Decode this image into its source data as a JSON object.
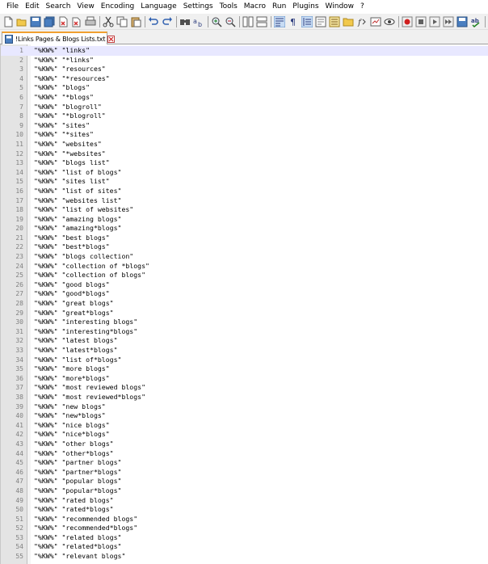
{
  "menu": [
    "File",
    "Edit",
    "Search",
    "View",
    "Encoding",
    "Language",
    "Settings",
    "Tools",
    "Macro",
    "Run",
    "Plugins",
    "Window",
    "?"
  ],
  "tab": {
    "title": "!Links Pages & Blogs Lists.txt",
    "icon": "file-saved-icon"
  },
  "colors": {
    "gutter_bg": "#e4e4e4",
    "current_line_bg": "#e8e8ff",
    "tab_accent": "#f0a030"
  },
  "editor": {
    "lines": [
      {
        "n": "1",
        "text": "\"%KW%\" \"links\""
      },
      {
        "n": "2",
        "text": "\"%KW%\" \"*links\""
      },
      {
        "n": "3",
        "text": "\"%KW%\" \"resources\""
      },
      {
        "n": "4",
        "text": "\"%KW%\" \"*resources\""
      },
      {
        "n": "5",
        "text": "\"%KW%\" \"blogs\""
      },
      {
        "n": "6",
        "text": "\"%KW%\" \"*blogs\""
      },
      {
        "n": "7",
        "text": "\"%KW%\" \"blogroll\""
      },
      {
        "n": "8",
        "text": "\"%KW%\" \"*blogroll\""
      },
      {
        "n": "9",
        "text": "\"%KW%\" \"sites\""
      },
      {
        "n": "10",
        "text": "\"%KW%\" \"*sites\""
      },
      {
        "n": "11",
        "text": "\"%KW%\" \"websites\""
      },
      {
        "n": "12",
        "text": "\"%KW%\" \"*websites\""
      },
      {
        "n": "13",
        "text": "\"%KW%\" \"blogs list\""
      },
      {
        "n": "14",
        "text": "\"%KW%\" \"list of blogs\""
      },
      {
        "n": "15",
        "text": "\"%KW%\" \"sites list\""
      },
      {
        "n": "16",
        "text": "\"%KW%\" \"list of sites\""
      },
      {
        "n": "17",
        "text": "\"%KW%\" \"websites list\""
      },
      {
        "n": "18",
        "text": "\"%KW%\" \"list of websites\""
      },
      {
        "n": "19",
        "text": "\"%KW%\" \"amazing blogs\""
      },
      {
        "n": "20",
        "text": "\"%KW%\" \"amazing*blogs\""
      },
      {
        "n": "21",
        "text": "\"%KW%\" \"best blogs\""
      },
      {
        "n": "22",
        "text": "\"%KW%\" \"best*blogs\""
      },
      {
        "n": "23",
        "text": "\"%KW%\" \"blogs collection\""
      },
      {
        "n": "24",
        "text": "\"%KW%\" \"collection of *blogs\""
      },
      {
        "n": "25",
        "text": "\"%KW%\" \"collection of blogs\""
      },
      {
        "n": "26",
        "text": "\"%KW%\" \"good blogs\""
      },
      {
        "n": "27",
        "text": "\"%KW%\" \"good*blogs\""
      },
      {
        "n": "28",
        "text": "\"%KW%\" \"great blogs\""
      },
      {
        "n": "29",
        "text": "\"%KW%\" \"great*blogs\""
      },
      {
        "n": "30",
        "text": "\"%KW%\" \"interesting blogs\""
      },
      {
        "n": "31",
        "text": "\"%KW%\" \"interesting*blogs\""
      },
      {
        "n": "32",
        "text": "\"%KW%\" \"latest blogs\""
      },
      {
        "n": "33",
        "text": "\"%KW%\" \"latest*blogs\""
      },
      {
        "n": "34",
        "text": "\"%KW%\" \"list of*blogs\""
      },
      {
        "n": "35",
        "text": "\"%KW%\" \"more blogs\""
      },
      {
        "n": "36",
        "text": "\"%KW%\" \"more*blogs\""
      },
      {
        "n": "37",
        "text": "\"%KW%\" \"most reviewed blogs\""
      },
      {
        "n": "38",
        "text": "\"%KW%\" \"most reviewed*blogs\""
      },
      {
        "n": "39",
        "text": "\"%KW%\" \"new blogs\""
      },
      {
        "n": "40",
        "text": "\"%KW%\" \"new*blogs\""
      },
      {
        "n": "41",
        "text": "\"%KW%\" \"nice blogs\""
      },
      {
        "n": "42",
        "text": "\"%KW%\" \"nice*blogs\""
      },
      {
        "n": "43",
        "text": "\"%KW%\" \"other blogs\""
      },
      {
        "n": "44",
        "text": "\"%KW%\" \"other*blogs\""
      },
      {
        "n": "45",
        "text": "\"%KW%\" \"partner blogs\""
      },
      {
        "n": "46",
        "text": "\"%KW%\" \"partner*blogs\""
      },
      {
        "n": "47",
        "text": "\"%KW%\" \"popular blogs\""
      },
      {
        "n": "48",
        "text": "\"%KW%\" \"popular*blogs\""
      },
      {
        "n": "49",
        "text": "\"%KW%\" \"rated blogs\""
      },
      {
        "n": "50",
        "text": "\"%KW%\" \"rated*blogs\""
      },
      {
        "n": "51",
        "text": "\"%KW%\" \"recommended blogs\""
      },
      {
        "n": "52",
        "text": "\"%KW%\" \"recommended*blogs\""
      },
      {
        "n": "53",
        "text": "\"%KW%\" \"related blogs\""
      },
      {
        "n": "54",
        "text": "\"%KW%\" \"related*blogs\""
      },
      {
        "n": "55",
        "text": "\"%KW%\" \"relevant blogs\""
      }
    ]
  }
}
